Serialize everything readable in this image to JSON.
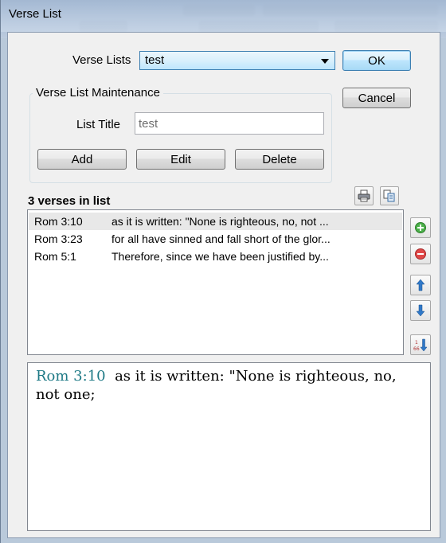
{
  "window": {
    "title": "Verse List"
  },
  "verse_lists": {
    "label": "Verse Lists",
    "selected": "test"
  },
  "buttons": {
    "ok": "OK",
    "cancel": "Cancel"
  },
  "maintenance": {
    "group_title": "Verse List Maintenance",
    "list_title_label": "List Title",
    "list_title_value": "test",
    "add": "Add",
    "edit": "Edit",
    "delete": "Delete"
  },
  "list": {
    "count_label": "3 verses in list",
    "verses": [
      {
        "ref": "Rom 3:10",
        "text": "as it is written: \"None is righteous, no, not ..."
      },
      {
        "ref": "Rom 3:23",
        "text": "for all have sinned and fall short of the glor..."
      },
      {
        "ref": "Rom 5:1",
        "text": "Therefore, since we have been justified by..."
      }
    ],
    "selected_index": 0
  },
  "side_icons": [
    "add-icon",
    "remove-icon",
    "move-up-icon",
    "move-down-icon",
    "sort-canonical-icon"
  ],
  "preview": {
    "ref": "Rom 3:10",
    "text": "as it is written: \"None is righteous, no, not one;"
  },
  "colors": {
    "preview_ref": "#1f7a86",
    "selection": "#e8e8e8",
    "accent": "#3c7fb1"
  }
}
